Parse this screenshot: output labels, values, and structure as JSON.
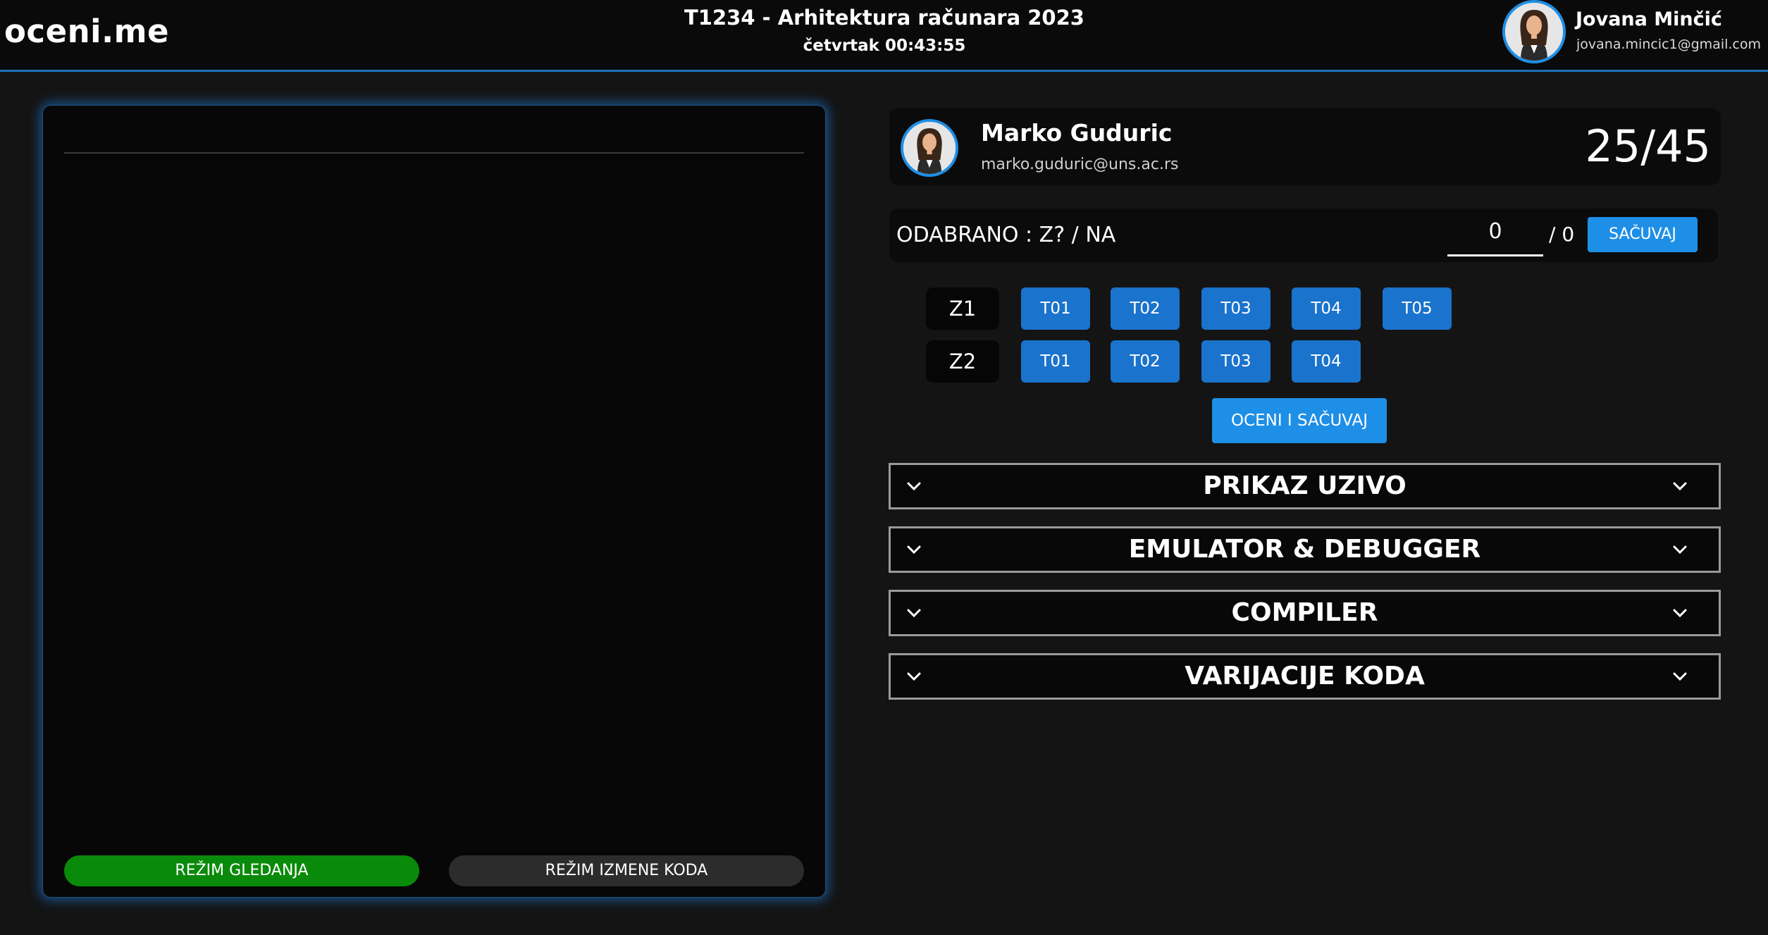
{
  "header": {
    "logo": "oceni.me",
    "course_title": "T1234 - Arhitektura računara 2023",
    "clock": "četvrtak 00:43:55",
    "user": {
      "name": "Jovana Minčić",
      "email": "jovana.mincic1@gmail.com"
    }
  },
  "code_panel": {
    "mode_view_label": "REŽIM GLEDANJA",
    "mode_edit_label": "REŽIM IZMENE KODA",
    "active_mode_color": "#0a8a0a"
  },
  "student": {
    "name": "Marko Guduric",
    "email": "marko.guduric@uns.ac.rs",
    "score": "25/45"
  },
  "selection": {
    "label": "ODABRANO : Z? / NA",
    "points_value": "0",
    "points_max": "/ 0",
    "save_label": "SAČUVAJ"
  },
  "tasks": [
    {
      "label": "Z1",
      "tests": [
        "T01",
        "T02",
        "T03",
        "T04",
        "T05"
      ]
    },
    {
      "label": "Z2",
      "tests": [
        "T01",
        "T02",
        "T03",
        "T04"
      ]
    }
  ],
  "grade_button_label": "OCENI I SAČUVAJ",
  "accordions": [
    {
      "title": "PRIKAZ UZIVO"
    },
    {
      "title": "EMULATOR & DEBUGGER"
    },
    {
      "title": "COMPILER"
    },
    {
      "title": "VARIJACIJE KODA"
    }
  ],
  "icons": {
    "accordion_expand": "chevron-down-icon",
    "avatar": "avatar-icon"
  },
  "colors": {
    "accent": "#1e8fe6",
    "test_button": "#1a73cc",
    "header_border": "#1e6fb8"
  }
}
